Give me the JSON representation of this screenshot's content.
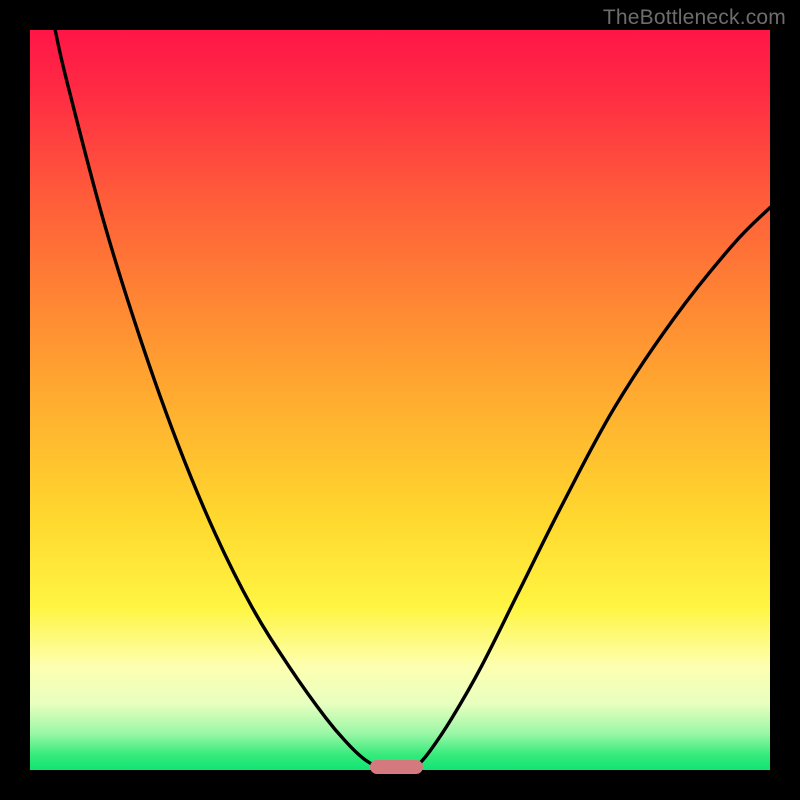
{
  "watermark": "TheBottleneck.com",
  "chart_data": {
    "type": "line",
    "title": "",
    "xlabel": "",
    "ylabel": "",
    "xlim": [
      0,
      100
    ],
    "ylim": [
      0,
      100
    ],
    "series": [
      {
        "name": "left-curve",
        "x": [
          3.4,
          5,
          10,
          15,
          20,
          25,
          30,
          35,
          40,
          43,
          45,
          46.7
        ],
        "values": [
          100,
          93,
          74,
          58,
          44,
          32,
          22,
          14,
          7,
          3.5,
          1.6,
          0.5
        ]
      },
      {
        "name": "right-curve",
        "x": [
          52.3,
          54,
          57,
          61,
          66,
          72,
          79,
          87,
          95,
          100
        ],
        "values": [
          0.5,
          2.5,
          7,
          14,
          24,
          36,
          49,
          61,
          71,
          76
        ]
      }
    ],
    "marker": {
      "name": "optimal-range",
      "x0": 45.9,
      "x1": 53.1,
      "y": 0.4,
      "color": "#d47a7e"
    },
    "background_gradient": {
      "top": "#ff1647",
      "middle": "#ffd82e",
      "bottom": "#11e376"
    }
  }
}
